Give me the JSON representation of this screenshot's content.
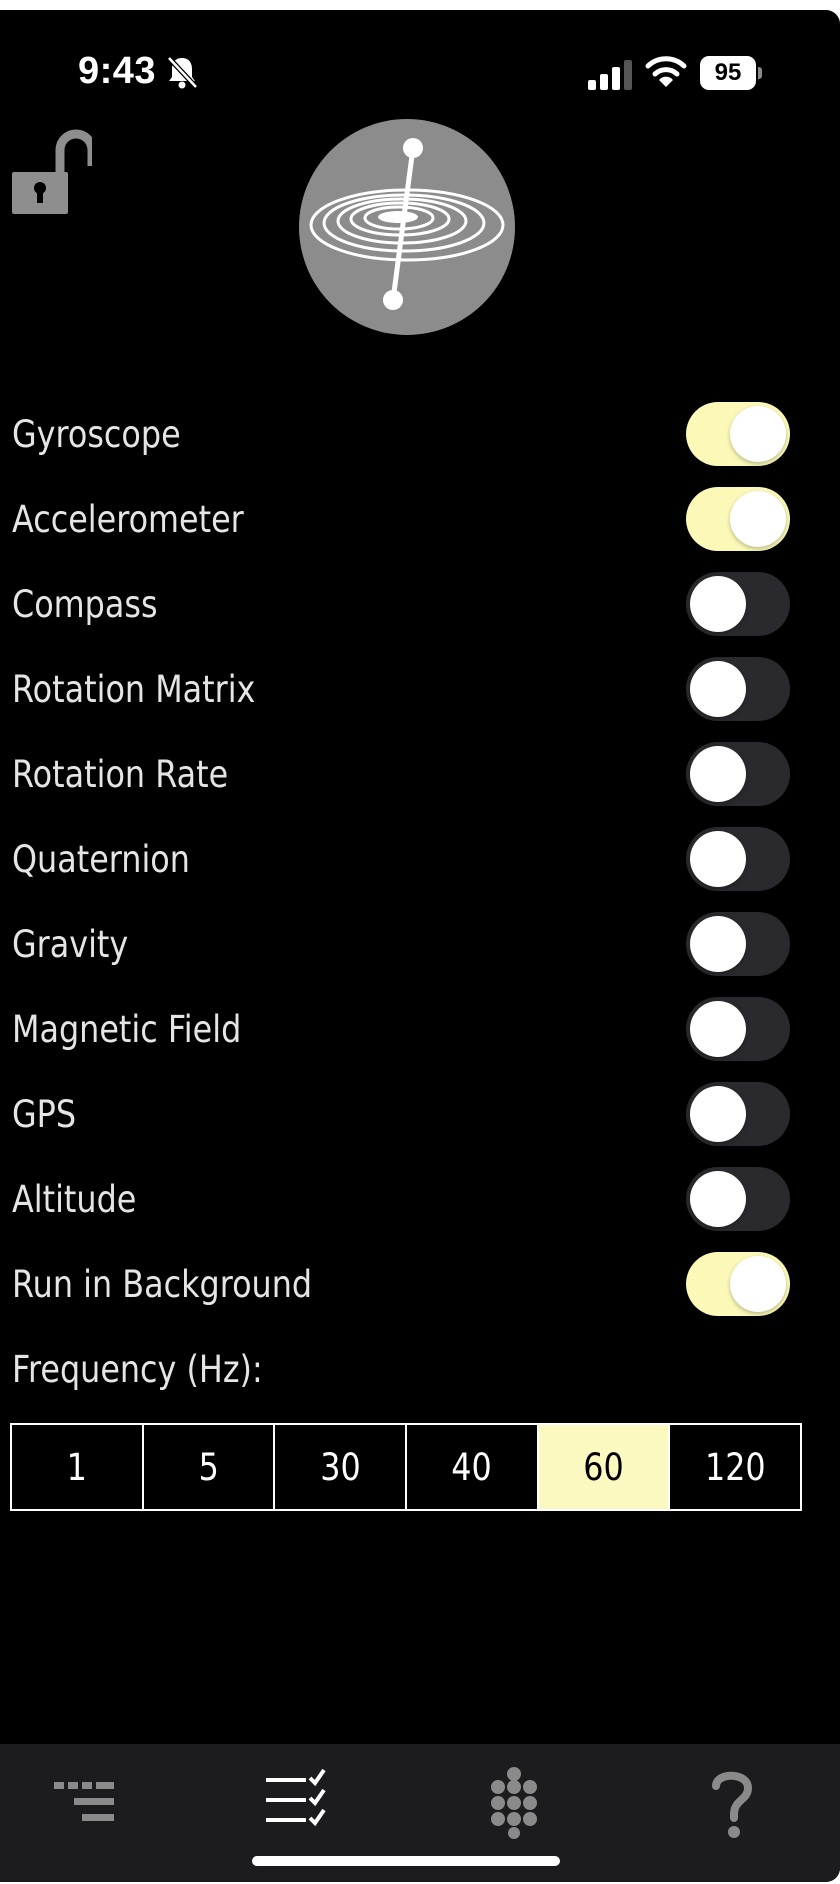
{
  "status_bar": {
    "time": "9:43",
    "battery": "95",
    "icons": [
      "bell-off-icon",
      "cellular-signal-icon",
      "wifi-icon",
      "battery-icon"
    ]
  },
  "header": {
    "lock_icon": "unlocked-padlock-icon",
    "logo_icon": "gyroscope-logo-icon"
  },
  "settings": {
    "rows": [
      {
        "label": "Gyroscope",
        "on": true
      },
      {
        "label": "Accelerometer",
        "on": true
      },
      {
        "label": "Compass",
        "on": false
      },
      {
        "label": "Rotation Matrix",
        "on": false
      },
      {
        "label": "Rotation Rate",
        "on": false
      },
      {
        "label": "Quaternion",
        "on": false
      },
      {
        "label": "Gravity",
        "on": false
      },
      {
        "label": "Magnetic Field",
        "on": false
      },
      {
        "label": "GPS",
        "on": false
      },
      {
        "label": "Altitude",
        "on": false
      },
      {
        "label": "Run in Background",
        "on": true
      }
    ]
  },
  "frequency": {
    "label": "Frequency (Hz):",
    "options": [
      "1",
      "5",
      "30",
      "40",
      "60",
      "120"
    ],
    "selected": "60"
  },
  "tab_bar": {
    "tabs": [
      "data-lines-icon",
      "checklist-icon",
      "dot-grid-icon",
      "help-question-icon"
    ],
    "selected_index": 1
  },
  "colors": {
    "background": "#000000",
    "accent": "#fbf8b8",
    "toggle_off": "#2a2a2e",
    "tab_bar": "#1c1c1e",
    "label_text": "#e5e5e5"
  }
}
